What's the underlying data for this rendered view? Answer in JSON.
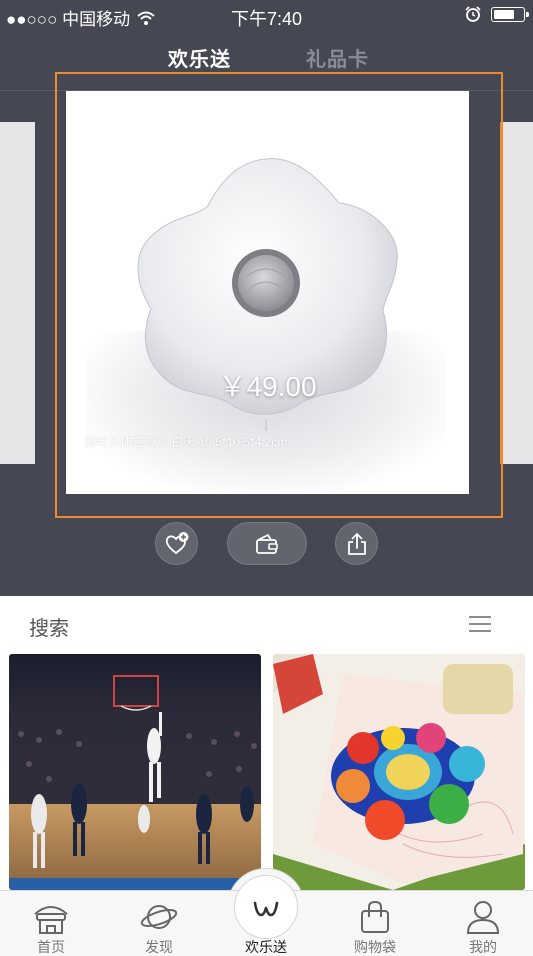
{
  "status_bar": {
    "carrier": "●●○○○ 中国移动",
    "time": "下午7:40"
  },
  "top_tabs": [
    {
      "label": "欢乐送",
      "active": true
    },
    {
      "label": "礼品卡",
      "active": false
    }
  ],
  "card": {
    "price": "￥49.00",
    "caption": "周叶人体感应灯 白天  10.5*10.5*4.2cm"
  },
  "actions": {
    "like_icon": "heart-plus-icon",
    "wallet_icon": "wallet-icon",
    "share_icon": "share-icon"
  },
  "search": {
    "label": "搜索"
  },
  "tabbar": {
    "items": [
      {
        "label": "首页",
        "icon": "home-icon"
      },
      {
        "label": "发现",
        "icon": "planet-icon"
      },
      {
        "label": "欢乐送",
        "icon": "w-logo-icon"
      },
      {
        "label": "购物袋",
        "icon": "shopping-bag-icon"
      },
      {
        "label": "我的",
        "icon": "user-icon"
      }
    ]
  },
  "colors": {
    "dark_bg": "#454852",
    "highlight_border": "#f08a2e",
    "tab_inactive": "#8a8d96"
  }
}
